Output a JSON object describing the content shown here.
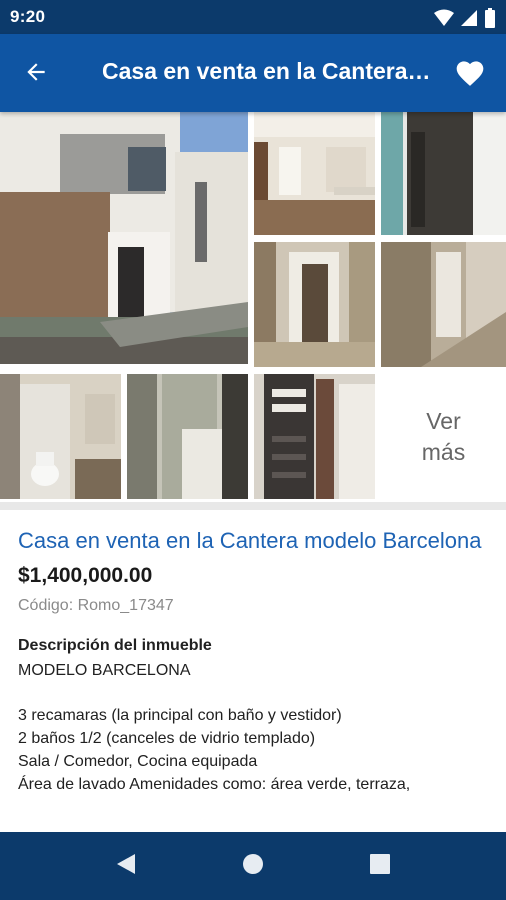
{
  "status_bar": {
    "time": "9:20",
    "icons": [
      "wifi-icon",
      "signal-icon",
      "battery-icon"
    ]
  },
  "app_bar": {
    "title": "Casa en venta en la Cantera modelo Barcelona",
    "back_icon": "arrow-back-icon",
    "favorite_icon": "heart-icon"
  },
  "gallery": {
    "photo_count_shown": 8,
    "see_more_line1": "Ver",
    "see_more_line2": "más"
  },
  "listing": {
    "title": "Casa en venta en la Cantera modelo Barcelona",
    "price": "$1,400,000.00",
    "code": "Código: Romo_17347",
    "description_heading": "Descripción del inmueble",
    "description_intro": "MODELO BARCELONA",
    "description_lines": [
      "3 recamaras (la principal con baño y vestidor)",
      "2 baños 1/2 (canceles de vidrio templado)",
      "Sala / Comedor, Cocina equipada",
      "Área de lavado Amenidades como: área verde, terraza,"
    ]
  },
  "nav_bar": {
    "buttons": [
      "back-triangle-icon",
      "home-circle-icon",
      "recents-square-icon"
    ]
  },
  "colors": {
    "status_bar": "#0c3a6b",
    "app_bar": "#0f55a3",
    "title_link": "#1e63b4",
    "nav_bar": "#0c3a6b"
  }
}
